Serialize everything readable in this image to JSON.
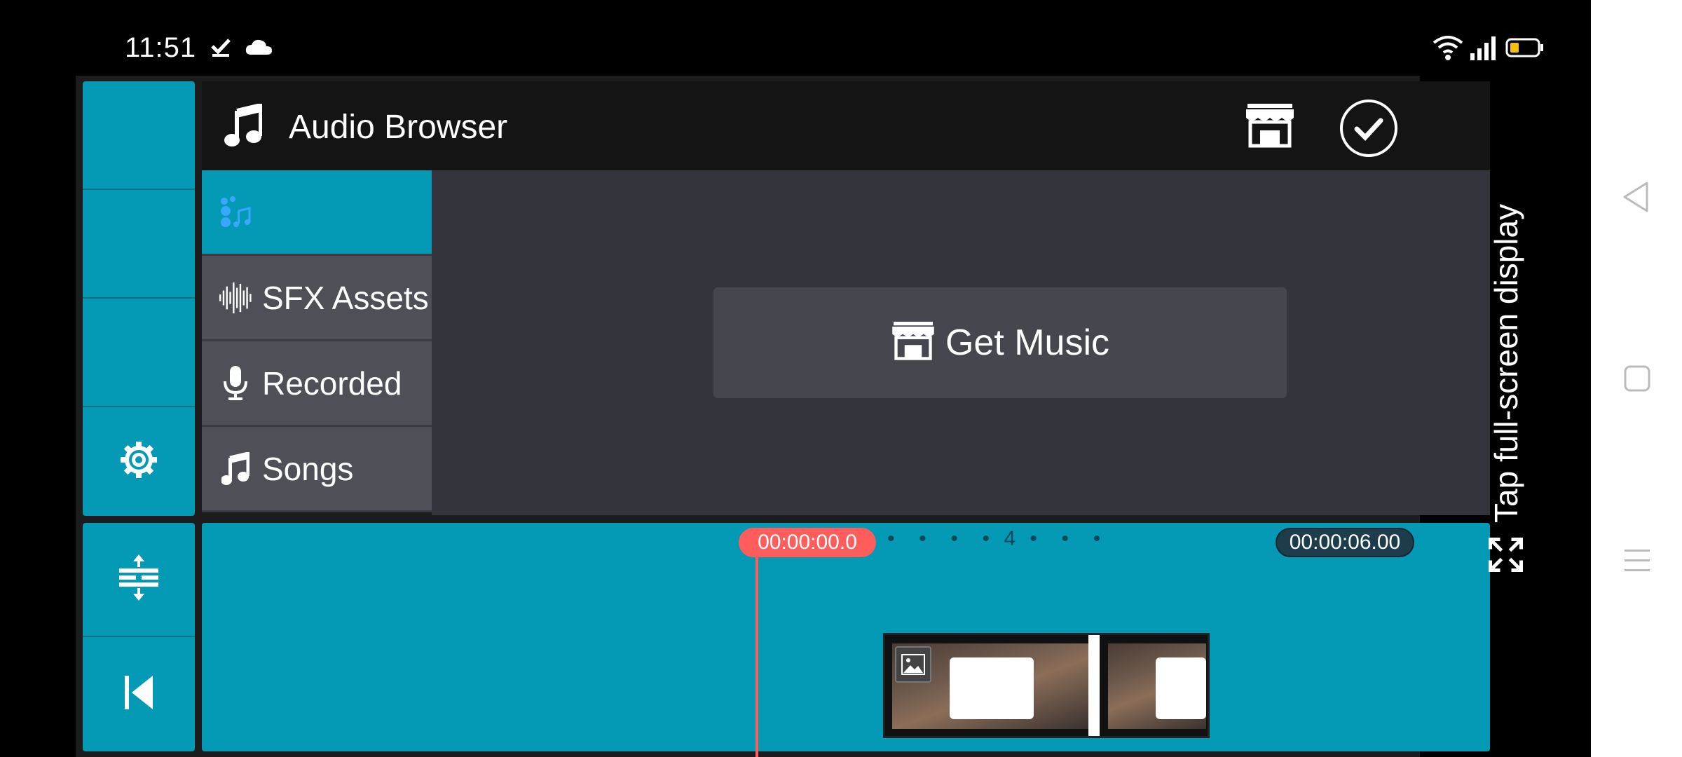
{
  "status_bar": {
    "time": "11:51",
    "left_icons": [
      "check-icon",
      "cloud-icon"
    ],
    "right_icons": [
      "wifi-icon",
      "signal-icon",
      "battery-icon"
    ],
    "battery_color": "#f2c200"
  },
  "left_toolbar": {
    "top_icons": [
      "blank",
      "blank",
      "blank",
      "settings-gear-icon"
    ],
    "bottom_icons": [
      "timeline-expand-icon",
      "skip-to-start-icon"
    ]
  },
  "audio_browser": {
    "title": "Audio Browser",
    "title_icon": "music-note-icon",
    "store_icon": "store-icon",
    "done_icon": "checkmark-circle-icon",
    "categories": [
      {
        "label": "",
        "icon": "music-assets-icon",
        "active": true
      },
      {
        "label": "SFX Assets",
        "icon": "waveform-icon",
        "active": false
      },
      {
        "label": "Recorded",
        "icon": "microphone-icon",
        "active": false
      },
      {
        "label": "Songs",
        "icon": "music-note-icon",
        "active": false
      }
    ],
    "get_music_label": "Get Music"
  },
  "timeline": {
    "current_time": "00:00:00.0",
    "total_time": "00:00:06.00",
    "ruler_marker": "4",
    "accent_color": "#0499b5",
    "playhead_color": "#ff5c5c"
  },
  "fullscreen_hint": "Tap full-screen display",
  "nav_bar": {
    "buttons": [
      "back-icon",
      "home-icon",
      "recents-icon"
    ]
  }
}
